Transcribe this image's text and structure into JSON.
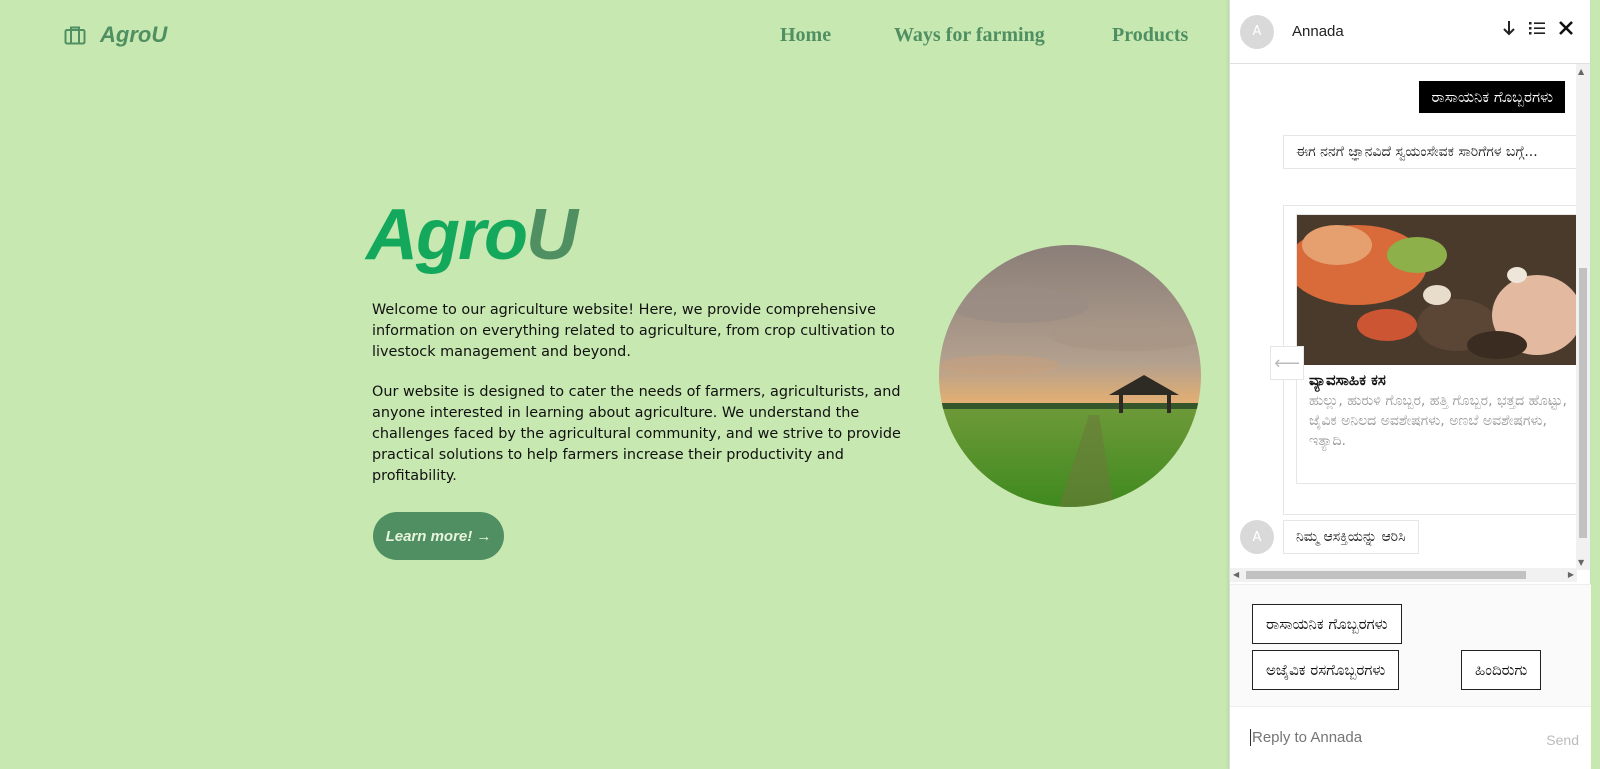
{
  "header": {
    "logo_text": "AgroU",
    "nav": {
      "home": "Home",
      "ways": "Ways for farming",
      "products": "Products"
    }
  },
  "hero": {
    "title_part1": "Agro",
    "title_part2": "U",
    "paragraph1": "Welcome to our agriculture website! Here, we provide comprehensive information on everything related to agriculture, from crop cultivation to livestock management and beyond.",
    "paragraph2": "Our website is designed to cater the needs of farmers, agriculturists, and anyone interested in learning about agriculture. We understand the challenges faced by the agricultural community, and we strive to provide practical solutions to help farmers increase their productivity and profitability.",
    "learn_more": "Learn more! →"
  },
  "chat": {
    "avatar_letter": "A",
    "name": "Annada",
    "icons": [
      "arrow-down-icon",
      "list-icon",
      "close-icon"
    ],
    "user_message": "ರಾಸಾಯನಿಕ ಗೊಬ್ಬರಗಳು",
    "bot_message_1": "ಈಗ ನನಗೆ ಜ್ಞಾನವಿದೆ ಸ್ವಯಂಸೇವಕ ಸಾರಿಗೆಗಳ ಬಗ್ಗೆ...",
    "card": {
      "title": "ವ್ಯಾವಸಾಹಿಕ ಕಸ",
      "description": "ಹುಲ್ಲು, ಹುರುಳಿ ಗೊಬ್ಬರ, ಹತ್ತಿ ಗೊಬ್ಬರ, ಭತ್ತದ ಹೊಟ್ಟು, ಜೈವಿಕ ಅನಿಲದ ಅವಶೇಷಗಳು, ಅಣಬೆ ಅವಶೇಷಗಳು, ಇತ್ಯಾದಿ."
    },
    "prev_arrow": "⟵",
    "bot_message_2": "ನಿಮ್ಮ ಆಸಕ್ತಿಯನ್ನು ಆರಿಸಿ",
    "quick_replies": [
      "ರಾಸಾಯನಿಕ ಗೊಬ್ಬರಗಳು",
      "ಅಜೈವಿಕ ರಸಗೊಬ್ಬರಗಳು",
      "ಹಿಂದಿರುಗು"
    ],
    "reply_placeholder": "Reply to Annada",
    "send_label": "Send"
  },
  "colors": {
    "page_bg": "#c7e8b0",
    "brand_green": "#4f8f62",
    "title_green": "#14a85d"
  }
}
